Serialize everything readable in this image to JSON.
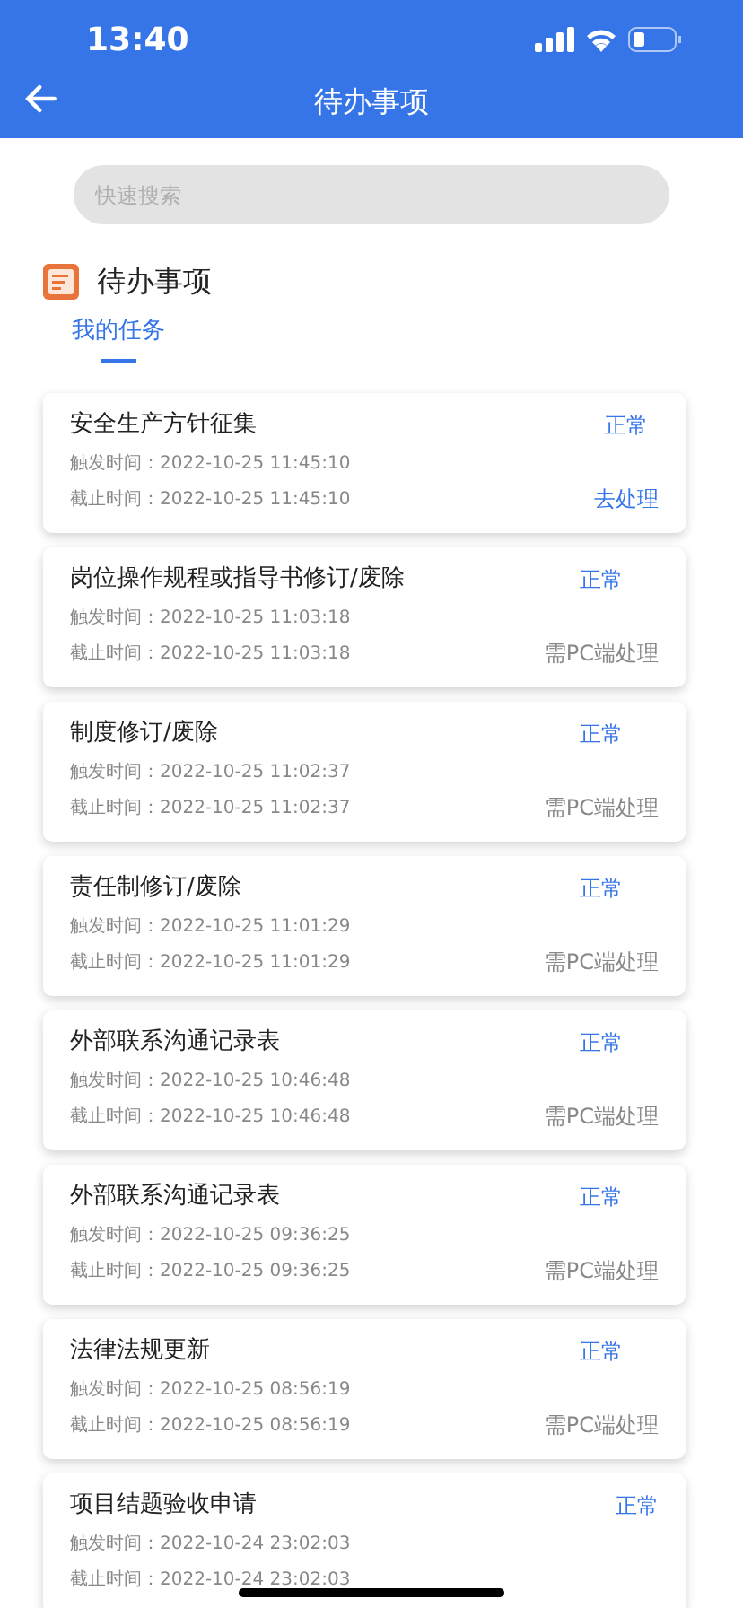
{
  "status_bar": {
    "time": "13:40"
  },
  "header": {
    "title": "待办事项"
  },
  "search": {
    "placeholder": "快速搜索"
  },
  "section": {
    "title": "待办事项"
  },
  "tabs": [
    {
      "label": "我的任务",
      "selected": true
    }
  ],
  "tasks": [
    {
      "title": "安全生产方针征集",
      "status": "正常",
      "trigger": "触发时间：2022-10-25 11:45:10",
      "deadline": "截止时间：2022-10-25 11:45:10",
      "action": {
        "kind": "button",
        "label": "去处理"
      }
    },
    {
      "title": "岗位操作规程或指导书修订/废除",
      "status": "正常",
      "trigger": "触发时间：2022-10-25 11:03:18",
      "deadline": "截止时间：2022-10-25 11:03:18",
      "action": {
        "kind": "note",
        "label": "需PC端处理"
      }
    },
    {
      "title": "制度修订/废除",
      "status": "正常",
      "trigger": "触发时间：2022-10-25 11:02:37",
      "deadline": "截止时间：2022-10-25 11:02:37",
      "action": {
        "kind": "note",
        "label": "需PC端处理"
      }
    },
    {
      "title": "责任制修订/废除",
      "status": "正常",
      "trigger": "触发时间：2022-10-25 11:01:29",
      "deadline": "截止时间：2022-10-25 11:01:29",
      "action": {
        "kind": "note",
        "label": "需PC端处理"
      }
    },
    {
      "title": "外部联系沟通记录表",
      "status": "正常",
      "trigger": "触发时间：2022-10-25 10:46:48",
      "deadline": "截止时间：2022-10-25 10:46:48",
      "action": {
        "kind": "note",
        "label": "需PC端处理"
      }
    },
    {
      "title": "外部联系沟通记录表",
      "status": "正常",
      "trigger": "触发时间：2022-10-25 09:36:25",
      "deadline": "截止时间：2022-10-25 09:36:25",
      "action": {
        "kind": "note",
        "label": "需PC端处理"
      }
    },
    {
      "title": "法律法规更新",
      "status": "正常",
      "trigger": "触发时间：2022-10-25 08:56:19",
      "deadline": "截止时间：2022-10-25 08:56:19",
      "action": {
        "kind": "note",
        "label": "需PC端处理"
      }
    },
    {
      "title": "项目结题验收申请",
      "status": "正常",
      "trigger": "触发时间：2022-10-24 23:02:03",
      "deadline": "截止时间：2022-10-24 23:02:03"
    }
  ]
}
